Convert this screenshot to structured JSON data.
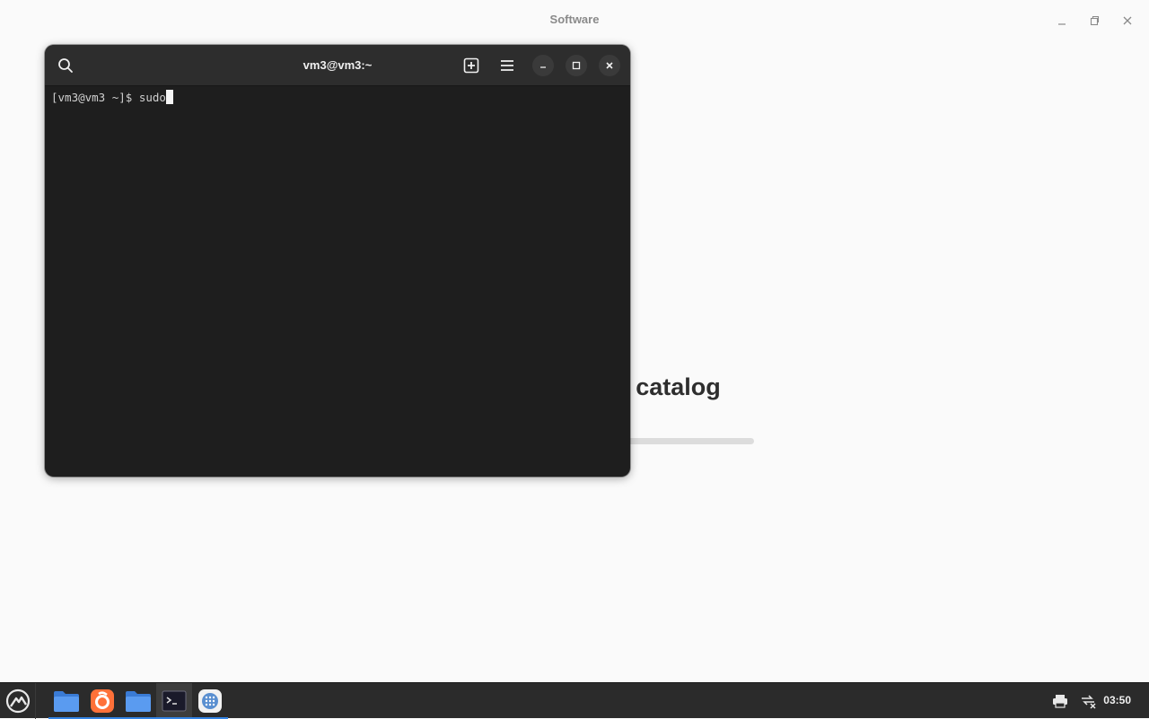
{
  "software_window": {
    "title": "Software",
    "loading_text": "Loading software catalog",
    "progress_fraction": 0.1
  },
  "terminal": {
    "title": "vm3@vm3:~",
    "prompt": "[vm3@vm3 ~]$ ",
    "input": "sudo"
  },
  "taskbar": {
    "clock": "03:50",
    "apps": [
      {
        "name": "files",
        "icon": "folder-icon",
        "accent": "#3584e4"
      },
      {
        "name": "firefox",
        "icon": "firefox-icon",
        "accent": "#3584e4"
      },
      {
        "name": "files-2",
        "icon": "folder-icon",
        "accent": "#3584e4"
      },
      {
        "name": "terminal",
        "icon": "terminal-icon",
        "accent": "#3584e4"
      },
      {
        "name": "software",
        "icon": "software-icon",
        "accent": "#3584e4"
      }
    ]
  },
  "colors": {
    "terminal_bg": "#1e1e1e",
    "terminal_header": "#2d2d2d",
    "taskbar_bg": "#2b2b2b",
    "accent_blue": "#3584e4",
    "firefox_orange": "#ff7139"
  }
}
